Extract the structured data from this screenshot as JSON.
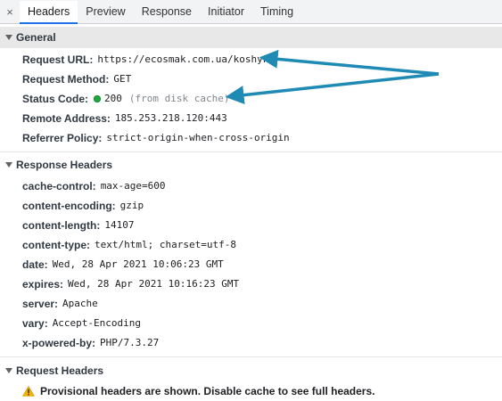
{
  "tabs": {
    "close": "×",
    "items": [
      "Headers",
      "Preview",
      "Response",
      "Initiator",
      "Timing"
    ]
  },
  "general": {
    "title": "General",
    "rows": [
      {
        "key": "Request URL:",
        "value": "https://ecosmak.com.ua/koshyk"
      },
      {
        "key": "Request Method:",
        "value": "GET"
      },
      {
        "key": "Status Code:",
        "value": "200",
        "note": "(from disk cache)"
      },
      {
        "key": "Remote Address:",
        "value": "185.253.218.120:443"
      },
      {
        "key": "Referrer Policy:",
        "value": "strict-origin-when-cross-origin"
      }
    ]
  },
  "response_headers": {
    "title": "Response Headers",
    "rows": [
      {
        "key": "cache-control:",
        "value": "max-age=600"
      },
      {
        "key": "content-encoding:",
        "value": "gzip"
      },
      {
        "key": "content-length:",
        "value": "14107"
      },
      {
        "key": "content-type:",
        "value": "text/html; charset=utf-8"
      },
      {
        "key": "date:",
        "value": "Wed, 28 Apr 2021 10:06:23 GMT"
      },
      {
        "key": "expires:",
        "value": "Wed, 28 Apr 2021 10:16:23 GMT"
      },
      {
        "key": "server:",
        "value": "Apache"
      },
      {
        "key": "vary:",
        "value": "Accept-Encoding"
      },
      {
        "key": "x-powered-by:",
        "value": "PHP/7.3.27"
      }
    ]
  },
  "request_headers": {
    "title": "Request Headers",
    "warning": "Provisional headers are shown. Disable cache to see full headers."
  },
  "colors": {
    "accent": "#1a73e8",
    "status_ok": "#1da93a",
    "annotation_arrow": "#1f8bb5",
    "warning": "#f4b400"
  }
}
